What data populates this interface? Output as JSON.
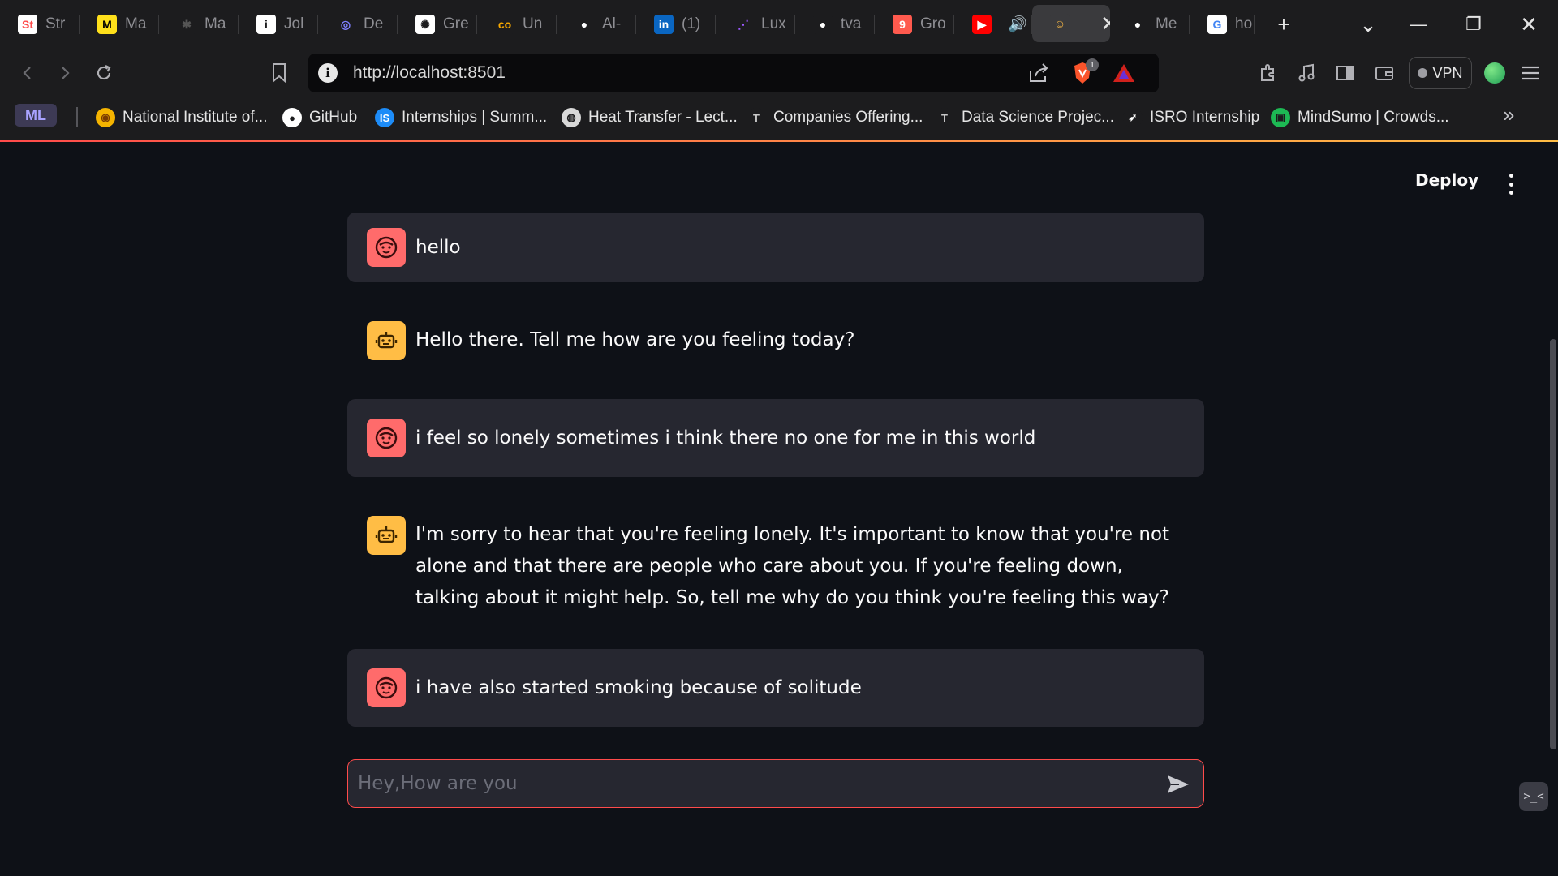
{
  "browser": {
    "tabs": [
      {
        "label": "Str",
        "favicon": "streamlit-doc-icon",
        "fav_bg": "#ffffff",
        "fav_fg": "#ff4b4b",
        "glyph": "St"
      },
      {
        "label": "Ma",
        "favicon": "mailchimp-icon",
        "fav_bg": "#ffe01b",
        "fav_fg": "#000000",
        "glyph": "M"
      },
      {
        "label": "Ma",
        "favicon": "figma-icon",
        "fav_bg": "#1c1c1e",
        "fav_fg": "#555555",
        "glyph": "✱"
      },
      {
        "label": "Jol",
        "favicon": "info-icon",
        "fav_bg": "#ffffff",
        "fav_fg": "#1c1c1e",
        "glyph": "i"
      },
      {
        "label": "De",
        "favicon": "dev-icon",
        "fav_bg": "#1c1c1e",
        "fav_fg": "#7f7fff",
        "glyph": "◎"
      },
      {
        "label": "Gre",
        "favicon": "openai-icon",
        "fav_bg": "#ffffff",
        "fav_fg": "#1c1c1e",
        "glyph": "✺"
      },
      {
        "label": "Un",
        "favicon": "coursera-icon",
        "fav_bg": "#1c1c1e",
        "fav_fg": "#f7a800",
        "glyph": "co"
      },
      {
        "label": "Al-",
        "favicon": "github-icon",
        "fav_bg": "#1c1c1e",
        "fav_fg": "#ffffff",
        "glyph": "●"
      },
      {
        "label": "(1)",
        "favicon": "linkedin-icon",
        "fav_bg": "#0a66c2",
        "fav_fg": "#ffffff",
        "glyph": "in"
      },
      {
        "label": "Lux",
        "favicon": "dots-icon",
        "fav_bg": "#1c1c1e",
        "fav_fg": "#9b59ff",
        "glyph": "⋰"
      },
      {
        "label": "tva",
        "favicon": "github-icon",
        "fav_bg": "#1c1c1e",
        "fav_fg": "#ffffff",
        "glyph": "●"
      },
      {
        "label": "Gro",
        "favicon": "notification-icon",
        "fav_bg": "#ff5a4e",
        "fav_fg": "#ffffff",
        "glyph": "9"
      },
      {
        "label": "",
        "favicon": "youtube-icon",
        "fav_bg": "#ff0000",
        "fav_fg": "#ffffff",
        "glyph": "▶",
        "audio": "🔊"
      },
      {
        "label": "",
        "favicon": "app-avatar-icon",
        "fav_bg": "#3a3a3d",
        "fav_fg": "#ffbd45",
        "glyph": "☺",
        "close": "✕",
        "active": true
      },
      {
        "label": "Me",
        "favicon": "github-icon",
        "fav_bg": "#1c1c1e",
        "fav_fg": "#ffffff",
        "glyph": "●"
      },
      {
        "label": "ho",
        "favicon": "google-icon",
        "fav_bg": "#ffffff",
        "fav_fg": "#4285f4",
        "glyph": "G"
      }
    ],
    "new_tab": "+",
    "tab_search": "⌄",
    "minimize": "—",
    "restore": "❐",
    "close": "✕",
    "url": "http://localhost:8501",
    "shields_count": "1",
    "vpn_label": "VPN",
    "bookmark_badge": "ML",
    "bookmarks": [
      {
        "label": "National Institute of...",
        "icon": "nit-logo-icon",
        "bg": "#f5b400",
        "fg": "#7a3a00",
        "glyph": "◉"
      },
      {
        "label": "GitHub",
        "icon": "github-icon",
        "bg": "#ffffff",
        "fg": "#1c1c1e",
        "glyph": "●"
      },
      {
        "label": "Internships | Summ...",
        "icon": "internshala-icon",
        "bg": "#1d8cf8",
        "fg": "#ffffff",
        "glyph": "IS"
      },
      {
        "label": "Heat Transfer - Lect...",
        "icon": "globe-icon",
        "bg": "#d8d8d8",
        "fg": "#1c1c1e",
        "glyph": "◍"
      },
      {
        "label": "Companies Offering...",
        "icon": "t-circle-icon",
        "bg": "#1c1c1e",
        "fg": "#c8c8c8",
        "glyph": "T"
      },
      {
        "label": "Data Science Projec...",
        "icon": "t-circle-icon",
        "bg": "#1c1c1e",
        "fg": "#c8c8c8",
        "glyph": "T"
      },
      {
        "label": "ISRO Internship",
        "icon": "isro-icon",
        "bg": "#1c1c1e",
        "fg": "#ffffff",
        "glyph": "➶"
      },
      {
        "label": "MindSumo | Crowds...",
        "icon": "mindsumo-icon",
        "bg": "#1db954",
        "fg": "#1c1c1e",
        "glyph": "▣"
      }
    ],
    "bookmarks_more": "»"
  },
  "app": {
    "deploy_label": "Deploy",
    "accent_color": "#ff4b4b",
    "messages": [
      {
        "role": "user",
        "avatar": "user-face-icon",
        "text": "hello"
      },
      {
        "role": "assistant",
        "avatar": "robot-icon",
        "text": "Hello there. Tell me how are you feeling today?"
      },
      {
        "role": "user",
        "avatar": "user-face-icon",
        "text": "i feel so lonely sometimes i think there no one for me in this world"
      },
      {
        "role": "assistant",
        "avatar": "robot-icon",
        "text": "I'm sorry to hear that you're feeling lonely. It's important to know that you're not alone and that there are people who care about you. If you're feeling down, talking about it might help. So, tell me why do you think you're feeling this way?"
      },
      {
        "role": "user",
        "avatar": "user-face-icon",
        "text": "i have also started smoking because of solitude"
      }
    ],
    "chat_input": {
      "value": "",
      "placeholder": "Hey,How are you"
    },
    "corner_widget": ">_<"
  }
}
